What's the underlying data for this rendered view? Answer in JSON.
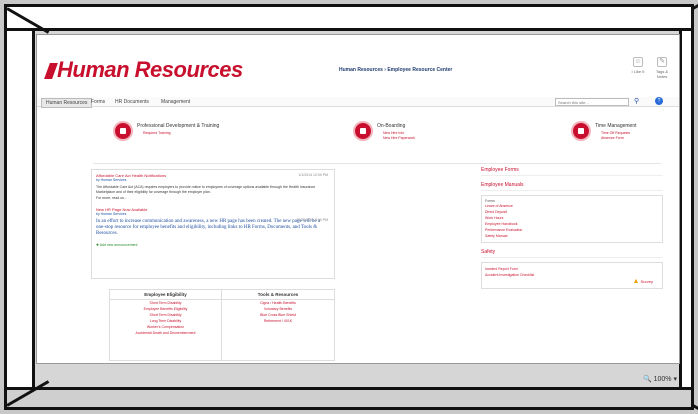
{
  "header": {
    "logo_text": "Human Resources",
    "breadcrumb": "Human Resources › Employee Resource Center",
    "actions": [
      {
        "label": "I Like It"
      },
      {
        "label": "Tags & Notes"
      }
    ]
  },
  "nav": {
    "tabs": [
      "Human Resources",
      "Forms",
      "HR Documents",
      "Management"
    ],
    "search_placeholder": "Search this site..."
  },
  "quicklinks": [
    {
      "title": "Professional Development & Training",
      "links": [
        "Required Training"
      ]
    },
    {
      "title": "On-Boarding",
      "links": [
        "New Hire Info",
        "New Hire Paperwork"
      ]
    },
    {
      "title": "Time Management",
      "links": [
        "Time Off Requests",
        "Absence Form"
      ]
    }
  ],
  "news": {
    "item1_title": "Affordable Care Act Health Notifications",
    "item1_author": "by Human Services",
    "item1_date": "1/1/2014 12:00 PM",
    "item1_body": "The Affordable Care Act (ACA) requires employers to provide notice to employees of coverage options available through the Health Insurance Marketplace and of their eligibility for coverage through the employer plan.",
    "item1_more": "For more, read on...",
    "item2_title": "New HR Page Now Available",
    "item2_author": "by Human Services",
    "item2_date": "12/23/2013 3:00 PM",
    "item2_body": "In an effort to increase communication and awareness, a new HR page has been created. The new page will be a one-stop resource for employee benefits and eligibility, including links to HR Forms, Documents, and Tools & Resources.",
    "add": "Add new announcement"
  },
  "eligibility": {
    "col1_title": "Employee Eligibility",
    "col1_items": [
      "Short Term Disability",
      "Employee Benefits Eligibility",
      "Short Term Disability",
      "Long Term Disability",
      "Worker's Compensation",
      "Accidental Death and Dismemberment"
    ],
    "col2_title": "Tools & Resources",
    "col2_items": [
      "Cigna / Health Benefits",
      "Voluntary Benefits",
      "Blue Cross Blue Shield",
      "Retirement / 401K"
    ]
  },
  "right_panel": {
    "forms_heading": "Employee Forms",
    "manuals_heading": "Employee Manuals",
    "manuals_label": "Forms",
    "manuals_links": [
      "Leave of Absence",
      "Direct Deposit",
      "Work Hours",
      "Employee Handbook",
      "Performance Evaluation",
      "Safety Manual"
    ],
    "safety_heading": "Safety",
    "safety_links": [
      "Incident Report Form",
      "Accident Investigation Checklist"
    ],
    "survey_label": "Survey"
  },
  "statusbar": {
    "zoom": "100%"
  },
  "colors": {
    "brand": "#c8102e",
    "link": "#1f4fa0"
  }
}
